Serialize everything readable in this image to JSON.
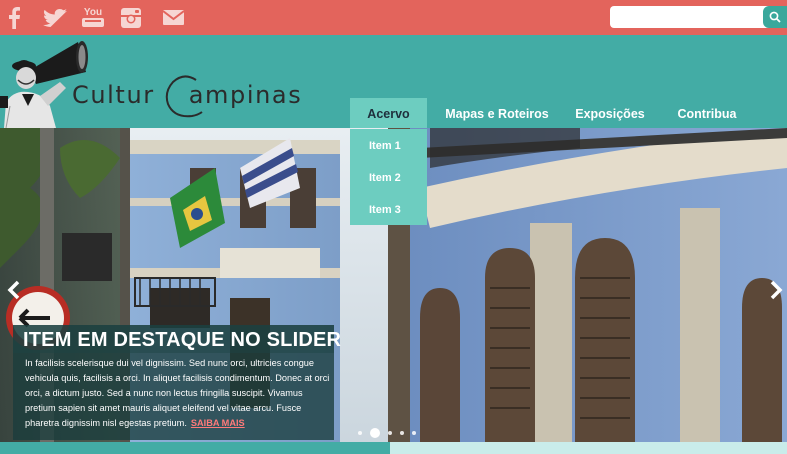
{
  "social": {
    "icons": [
      "facebook-icon",
      "twitter-icon",
      "youtube-icon",
      "instagram-icon",
      "mail-icon"
    ],
    "youtube_text": "You"
  },
  "search": {
    "placeholder": "",
    "value": ""
  },
  "logo": {
    "text": "Cultur",
    "text_tail": "ampinas"
  },
  "nav": {
    "items": [
      {
        "label": "Acervo",
        "active": true
      },
      {
        "label": "Mapas e Roteiros"
      },
      {
        "label": "Exposições"
      },
      {
        "label": "Contribua"
      }
    ],
    "dropdown": [
      "Item 1",
      "Item 2",
      "Item 3"
    ]
  },
  "slider": {
    "title": "ITEM EM DESTAQUE NO SLIDER",
    "body": "In facilisis scelerisque dui vel dignissim. Sed nunc orci, ultricies congue vehicula quis, facilisis a orci. In aliquet facilisis condimentum. Donec at orci orci, a dictum justo. Sed a nunc non lectus fringilla suscipit. Vivamus pretium sapien sit amet mauris aliquet eleifend vel vitae arcu. Fusce pharetra dignissim nisl egestas pretium.",
    "more_label": "SAIBA MAIS",
    "slide_count": 5,
    "active_slide": 2
  },
  "colors": {
    "topbar": "#e3645c",
    "header": "#43aca5",
    "nav_active": "#6dcdc0",
    "search_button": "#3aa89c"
  }
}
